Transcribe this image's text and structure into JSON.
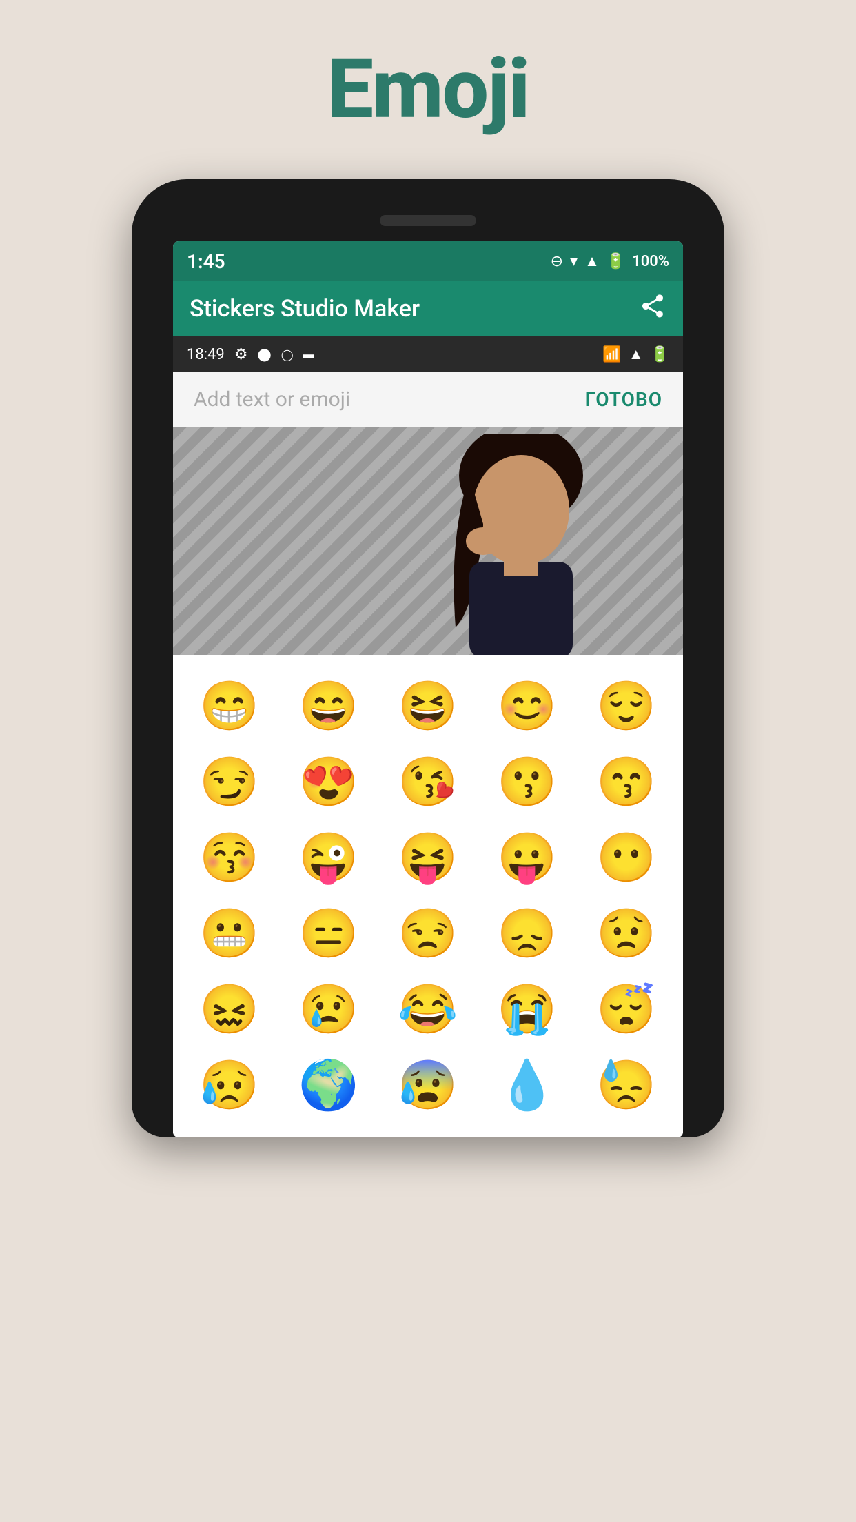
{
  "page": {
    "title": "Emoji",
    "background_color": "#e8e0d8",
    "title_color": "#2d7a6a"
  },
  "status_bar_top": {
    "time": "1:45",
    "battery": "100%",
    "icons": [
      "⊖",
      "▾",
      "▲",
      "🔋"
    ]
  },
  "app_bar": {
    "title": "Stickers Studio Maker",
    "share_icon": "share"
  },
  "status_bar_second": {
    "time": "18:49",
    "left_icons": [
      "⚙",
      "⬤",
      "◯",
      "▬"
    ],
    "right_icons": [
      "wifi",
      "signal",
      "battery"
    ]
  },
  "text_input": {
    "placeholder": "Add text or emoji",
    "done_button": "ГОТОВО"
  },
  "emojis": [
    "😁",
    "😄",
    "😆",
    "😊",
    "😌",
    "😏",
    "😍",
    "😘",
    "😗",
    "😙",
    "😚",
    "😜",
    "😝",
    "😛",
    "😶",
    "😬",
    "😑",
    "😒",
    "😞",
    "😟",
    "😖",
    "😢",
    "😂",
    "😭",
    "😴",
    "😥",
    "🌍",
    "😰",
    "💧",
    "😓"
  ]
}
